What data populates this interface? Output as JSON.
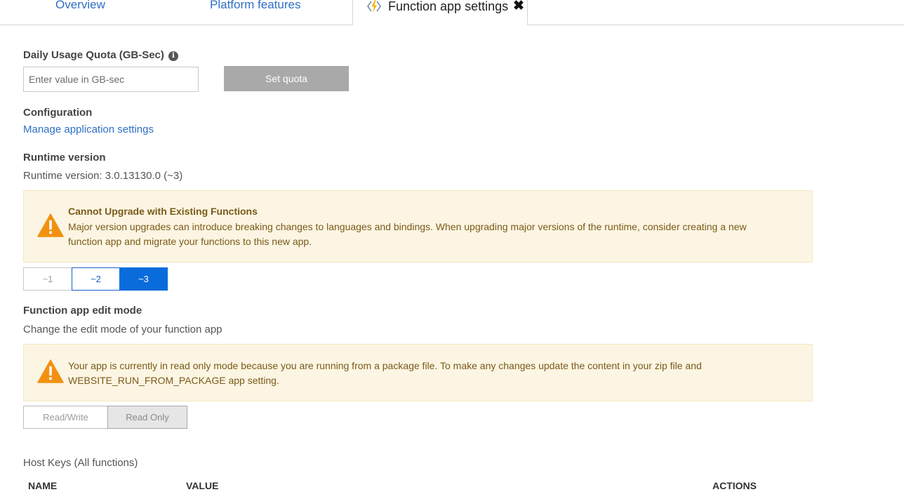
{
  "tabs": {
    "overview": "Overview",
    "platform_features": "Platform features",
    "active": "Function app settings"
  },
  "quota": {
    "title": "Daily Usage Quota (GB-Sec)",
    "placeholder": "Enter value in GB-sec",
    "button": "Set quota"
  },
  "configuration": {
    "title": "Configuration",
    "link": "Manage application settings"
  },
  "runtime": {
    "title": "Runtime version",
    "current": "Runtime version: 3.0.13130.0 (~3)",
    "warning_title": "Cannot Upgrade with Existing Functions",
    "warning_line1": "Major version upgrades can introduce breaking changes to languages and bindings. When upgrading major versions of the runtime, consider creating a new",
    "warning_line2": "function app and migrate your functions to this new app.",
    "options": [
      "~1",
      "~2",
      "~3"
    ],
    "selected": "~3"
  },
  "edit_mode": {
    "title": "Function app edit mode",
    "description": "Change the edit mode of your function app",
    "warning_line1": "Your app is currently in read only mode because you are running from a package file. To make any changes update the content in your zip file and",
    "warning_line2": "WEBSITE_RUN_FROM_PACKAGE app setting.",
    "options": [
      "Read/Write",
      "Read Only"
    ],
    "selected": "Read Only"
  },
  "host_keys": {
    "title": "Host Keys (All functions)",
    "columns": [
      "NAME",
      "VALUE",
      "ACTIONS"
    ]
  },
  "colors": {
    "link": "#2f6fc4",
    "accent": "#0a6cdb",
    "warning_bg": "#fcf5e3",
    "warning_icon": "#f29111",
    "disabled_button": "#a9a9a9"
  }
}
